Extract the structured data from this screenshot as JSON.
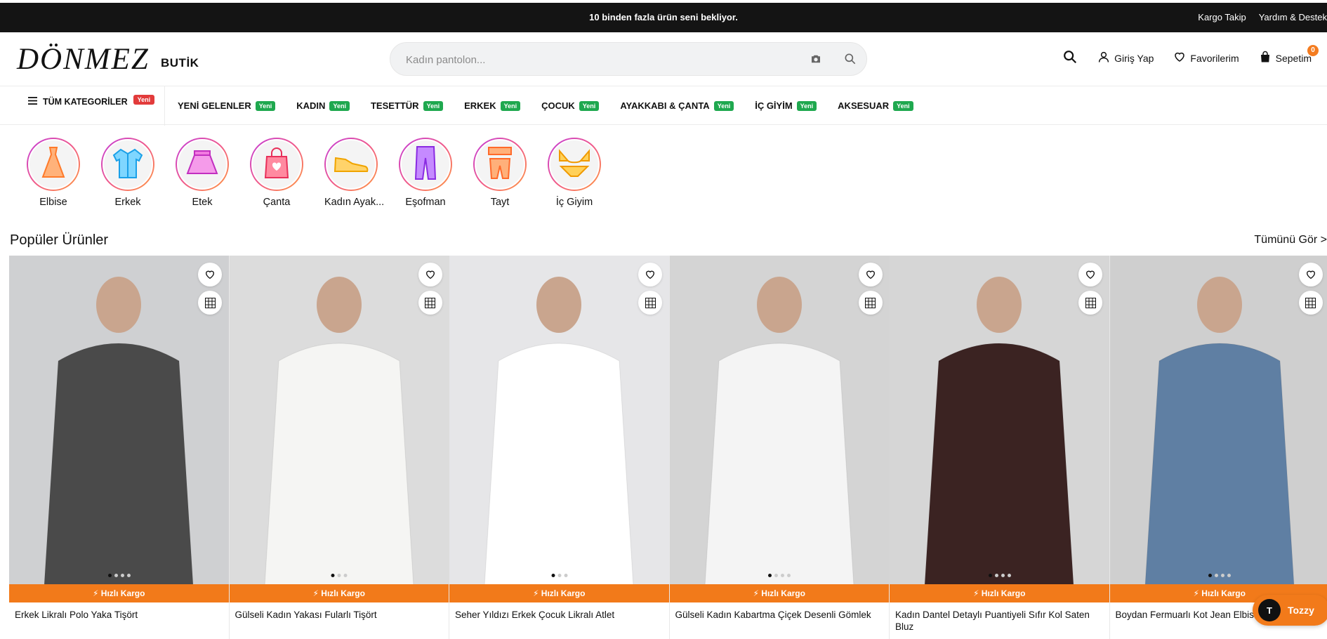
{
  "topbar": {
    "message": "10 binden fazla ürün seni bekliyor.",
    "links": [
      "Kargo Takip",
      "Yardım & Destek"
    ]
  },
  "header": {
    "logo_script": "DÖNMEZ",
    "logo_butik": "BUTİK",
    "search_placeholder": "Kadın pantolon...",
    "login": "Giriş Yap",
    "favorites": "Favorilerim",
    "cart": "Sepetim",
    "cart_count": "0"
  },
  "nav": {
    "all_categories": "TÜM KATEGORİLER",
    "all_categories_tag": "Yeni",
    "items": [
      {
        "label": "YENİ GELENLER",
        "tag": "Yeni"
      },
      {
        "label": "KADIN",
        "tag": "Yeni"
      },
      {
        "label": "TESETTÜR",
        "tag": "Yeni"
      },
      {
        "label": "ERKEK",
        "tag": "Yeni"
      },
      {
        "label": "ÇOCUK",
        "tag": "Yeni"
      },
      {
        "label": "AYAKKABI & ÇANTA",
        "tag": "Yeni"
      },
      {
        "label": "İÇ GİYİM",
        "tag": "Yeni"
      },
      {
        "label": "AKSESUAR",
        "tag": "Yeni"
      }
    ]
  },
  "categories": [
    {
      "label": "Elbise",
      "icon": "dress-icon"
    },
    {
      "label": "Erkek",
      "icon": "jacket-icon"
    },
    {
      "label": "Etek",
      "icon": "skirt-icon"
    },
    {
      "label": "Çanta",
      "icon": "bag-icon"
    },
    {
      "label": "Kadın Ayak...",
      "icon": "shoe-icon"
    },
    {
      "label": "Eşofman",
      "icon": "tracksuit-icon"
    },
    {
      "label": "Tayt",
      "icon": "leggings-icon"
    },
    {
      "label": "İç Giyim",
      "icon": "bikini-icon"
    }
  ],
  "section": {
    "title": "Popüler Ürünler",
    "see_all": "Tümünü Gör >"
  },
  "products": [
    {
      "name": "Erkek Likralı Polo Yaka Tişört",
      "badge": "⚡ Hızlı Kargo",
      "bg": "#cfd0d2",
      "garment": "#4a4a4a",
      "dots": 4
    },
    {
      "name": "Gülseli Kadın Yakası Fularlı Tişört",
      "badge": "⚡ Hızlı Kargo",
      "bg": "#dcdcdc",
      "garment": "#f5f5f3",
      "dots": 3
    },
    {
      "name": "Seher Yıldızı Erkek Çocuk Likralı Atlet",
      "badge": "⚡ Hızlı Kargo",
      "bg": "#e6e6e8",
      "garment": "#ffffff",
      "dots": 3
    },
    {
      "name": "Gülseli Kadın Kabartma Çiçek Desenli Gömlek",
      "badge": "⚡ Hızlı Kargo",
      "bg": "#d4d4d4",
      "garment": "#f4f4f4",
      "dots": 4
    },
    {
      "name": "Kadın Dantel Detaylı Puantiyeli Sıfır Kol Saten Bluz",
      "badge": "⚡ Hızlı Kargo",
      "bg": "#d6d6d6",
      "garment": "#3b2322",
      "dots": 4
    },
    {
      "name": "Boydan Fermuarlı Kot Jean Elbise",
      "badge": "⚡ Hızlı Kargo",
      "bg": "#cfcfcf",
      "garment": "#5f7fa3",
      "dots": 4
    }
  ],
  "chat": {
    "avatar": "T",
    "label": "Tozzy"
  }
}
